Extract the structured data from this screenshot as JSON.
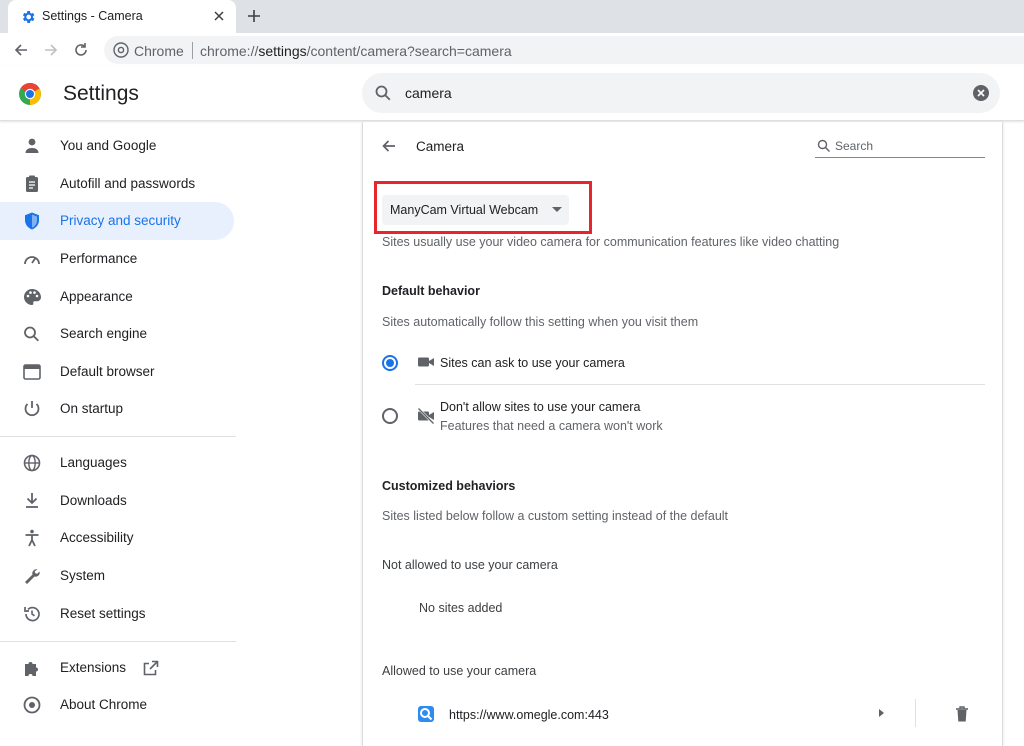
{
  "browser": {
    "tab_title": "Settings - Camera",
    "omnibox_chip": "Chrome",
    "url_prefix": "chrome://",
    "url_host": "settings",
    "url_rest": "/content/camera?search=camera"
  },
  "header": {
    "title": "Settings",
    "search_value": "camera"
  },
  "sidebar": {
    "items": [
      {
        "label": "You and Google",
        "icon": "person-icon"
      },
      {
        "label": "Autofill and passwords",
        "icon": "clipboard-icon"
      },
      {
        "label": "Privacy and security",
        "icon": "shield-icon",
        "active": true
      },
      {
        "label": "Performance",
        "icon": "speedometer-icon"
      },
      {
        "label": "Appearance",
        "icon": "palette-icon"
      },
      {
        "label": "Search engine",
        "icon": "search-icon"
      },
      {
        "label": "Default browser",
        "icon": "browser-window-icon"
      },
      {
        "label": "On startup",
        "icon": "power-icon"
      },
      {
        "label": "Languages",
        "icon": "globe-icon"
      },
      {
        "label": "Downloads",
        "icon": "download-icon"
      },
      {
        "label": "Accessibility",
        "icon": "accessibility-icon"
      },
      {
        "label": "System",
        "icon": "wrench-icon"
      },
      {
        "label": "Reset settings",
        "icon": "reset-history-icon"
      },
      {
        "label": "Extensions",
        "icon": "puzzle-icon"
      },
      {
        "label": "About Chrome",
        "icon": "chrome-logo-icon"
      }
    ]
  },
  "main": {
    "page_title": "Camera",
    "search_placeholder": "Search",
    "camera_select_value": "ManyCam Virtual Webcam",
    "camera_description": "Sites usually use your video camera for communication features like video chatting",
    "default_behavior": {
      "heading": "Default behavior",
      "description": "Sites automatically follow this setting when you visit them",
      "options": [
        {
          "label": "Sites can ask to use your camera",
          "sublabel": "",
          "checked": true
        },
        {
          "label": "Don't allow sites to use your camera",
          "sublabel": "Features that need a camera won't work",
          "checked": false
        }
      ]
    },
    "customized": {
      "heading": "Customized behaviors",
      "description": "Sites listed below follow a custom setting instead of the default",
      "not_allowed_heading": "Not allowed to use your camera",
      "not_allowed_empty": "No sites added",
      "allowed_heading": "Allowed to use your camera",
      "allowed_sites": [
        "https://www.omegle.com:443"
      ]
    }
  },
  "colors": {
    "accent": "#1a73e8",
    "highlight_box": "#e8252d",
    "active_nav_bg": "#e8f0fe"
  }
}
